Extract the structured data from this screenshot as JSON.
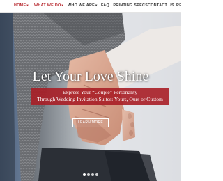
{
  "nav": {
    "items": [
      {
        "label": "HOME",
        "caret": "▾"
      },
      {
        "label": "WHAT WE DO",
        "caret": "▾"
      },
      {
        "label": "WHO WE ARE",
        "caret": "▾"
      },
      {
        "label": "FAQ | PRINTING SPECS",
        "caret": ""
      },
      {
        "label": "CONTACT US",
        "caret": ""
      },
      {
        "label": "RE",
        "caret": ""
      }
    ]
  },
  "hero": {
    "headline": "Let Your Love Shine",
    "banner_line_1": "Express Your “Couple” Personality",
    "banner_line_2": "Through Wedding Invitation Suites: Yours, Ours or Custom",
    "button_label": "LEARN MORE",
    "slide_count": 4,
    "active_slide": 1
  },
  "colors": {
    "accent": "#b72a30",
    "banner": "#a81e26",
    "nav_text": "#333333"
  }
}
